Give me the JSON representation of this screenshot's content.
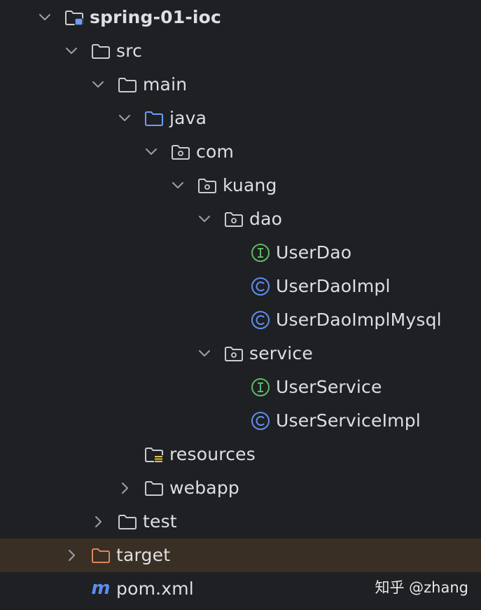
{
  "colors": {
    "background": "#1f2023",
    "text": "#dcdfe4",
    "chevron": "#9aa0a8",
    "folder_default": "#c9ccd2",
    "folder_source": "#6c9ef8",
    "folder_excluded": "#d9885a",
    "interface_icon": "#5fb865",
    "class_icon": "#5e8ff0",
    "maven_icon": "#5a8cf2",
    "resources_marker": "#e2c04a",
    "selected_row": "#3a2f24"
  },
  "tree": {
    "items": [
      {
        "label": "spring-01-ioc",
        "icon": "module-folder-icon",
        "expanded": true,
        "level": 0
      },
      {
        "label": "src",
        "icon": "folder-icon",
        "expanded": true,
        "level": 1
      },
      {
        "label": "main",
        "icon": "folder-icon",
        "expanded": true,
        "level": 2
      },
      {
        "label": "java",
        "icon": "source-folder-icon",
        "expanded": true,
        "level": 3
      },
      {
        "label": "com",
        "icon": "package-icon",
        "expanded": true,
        "level": 4
      },
      {
        "label": "kuang",
        "icon": "package-icon",
        "expanded": true,
        "level": 5
      },
      {
        "label": "dao",
        "icon": "package-icon",
        "expanded": true,
        "level": 6
      },
      {
        "label": "UserDao",
        "icon": "interface-icon",
        "level": 7
      },
      {
        "label": "UserDaoImpl",
        "icon": "class-icon",
        "level": 7
      },
      {
        "label": "UserDaoImplMysql",
        "icon": "class-icon",
        "level": 7
      },
      {
        "label": "service",
        "icon": "package-icon",
        "expanded": true,
        "level": 6
      },
      {
        "label": "UserService",
        "icon": "interface-icon",
        "level": 7
      },
      {
        "label": "UserServiceImpl",
        "icon": "class-icon",
        "level": 7
      },
      {
        "label": "resources",
        "icon": "resources-folder-icon",
        "level": 3
      },
      {
        "label": "webapp",
        "icon": "folder-icon",
        "expanded": false,
        "level": 3
      },
      {
        "label": "test",
        "icon": "folder-icon",
        "expanded": false,
        "level": 2
      },
      {
        "label": "target",
        "icon": "excluded-folder-icon",
        "expanded": false,
        "level": 1,
        "selected": true
      },
      {
        "label": "pom.xml",
        "icon": "maven-icon",
        "level": 1
      }
    ]
  },
  "watermark": "知乎 @zhang"
}
